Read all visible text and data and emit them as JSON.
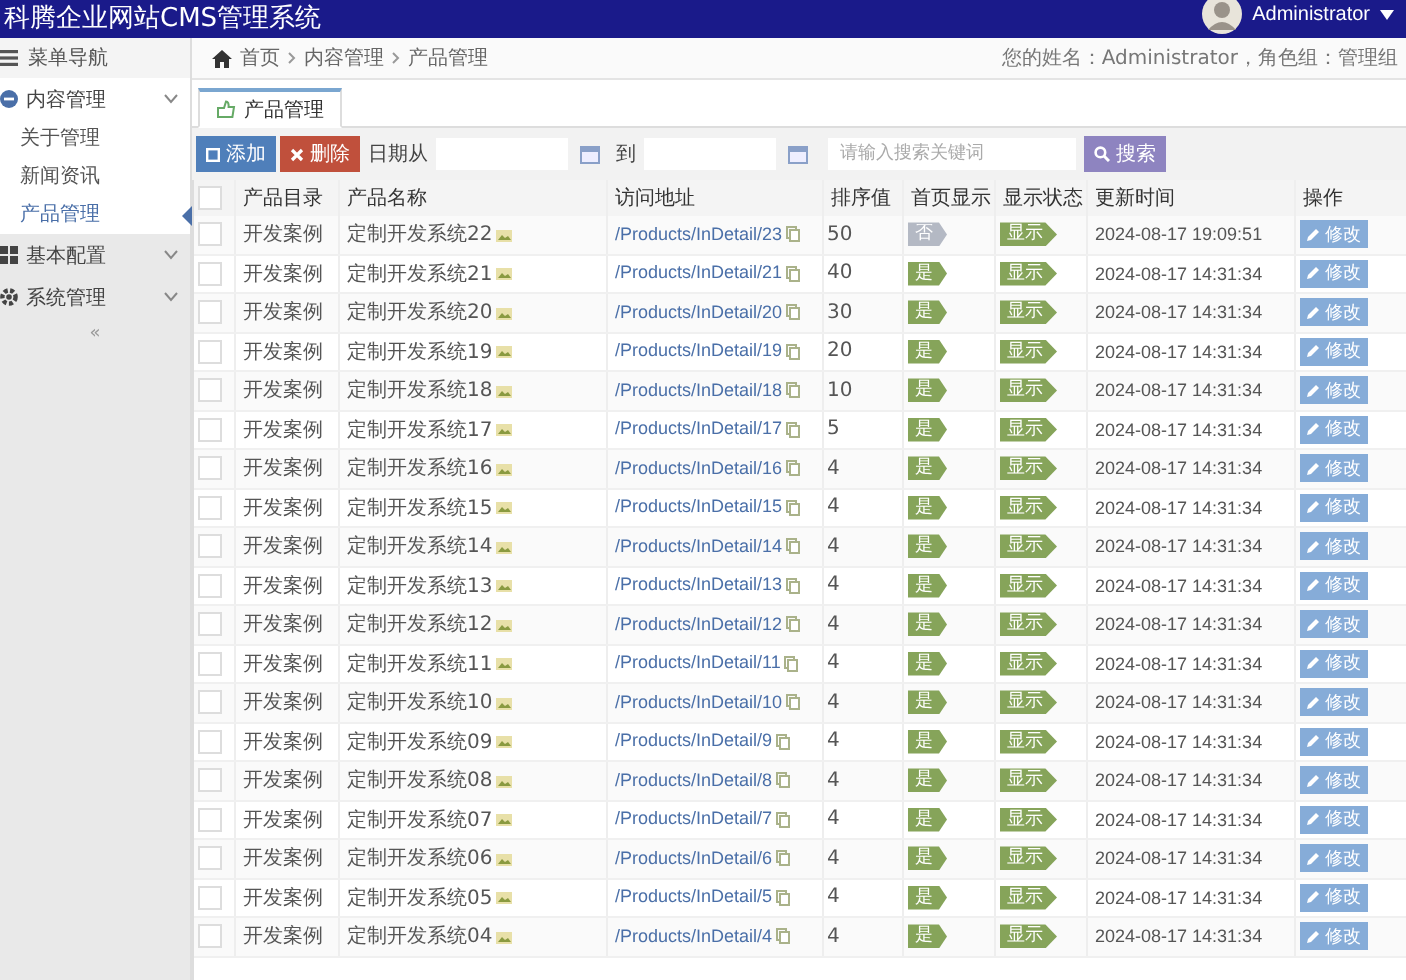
{
  "header": {
    "title": "科腾企业网站CMS管理系统",
    "user": "Administrator"
  },
  "sidebar": {
    "title": "菜单导航",
    "collapse": "«",
    "items": [
      {
        "label": "内容管理",
        "expanded": true,
        "children": [
          {
            "label": "关于管理",
            "selected": false
          },
          {
            "label": "新闻资讯",
            "selected": false
          },
          {
            "label": "产品管理",
            "selected": true
          }
        ]
      },
      {
        "label": "基本配置",
        "expanded": false
      },
      {
        "label": "系统管理",
        "expanded": false
      }
    ]
  },
  "breadcrumb": {
    "items": [
      "首页",
      "内容管理",
      "产品管理"
    ],
    "user_info": "您的姓名：Administrator，角色组：管理组"
  },
  "tabs": [
    {
      "label": "产品管理",
      "selected": true
    }
  ],
  "toolbar": {
    "add": "添加",
    "delete": "删除",
    "date_from": "日期从",
    "date_to": "到",
    "search_placeholder": "请输入搜索关键词",
    "search": "搜索"
  },
  "table": {
    "select_all_checked": false,
    "columns": [
      "产品目录",
      "产品名称",
      "访问地址",
      "排序值",
      "首页显示",
      "显示状态",
      "更新时间",
      "操作"
    ],
    "rows": [
      {
        "checked": false,
        "category": "开发案例",
        "name": "定制开发系统22",
        "url": "/Products/InDetail/23",
        "sort": "50",
        "home": {
          "text": "否",
          "on": false
        },
        "status": {
          "text": "显示",
          "on": true
        },
        "time": "2024-08-17 19:09:51",
        "action": "修改"
      },
      {
        "checked": false,
        "category": "开发案例",
        "name": "定制开发系统21",
        "url": "/Products/InDetail/21",
        "sort": "40",
        "home": {
          "text": "是",
          "on": true
        },
        "status": {
          "text": "显示",
          "on": true
        },
        "time": "2024-08-17 14:31:34",
        "action": "修改"
      },
      {
        "checked": false,
        "category": "开发案例",
        "name": "定制开发系统20",
        "url": "/Products/InDetail/20",
        "sort": "30",
        "home": {
          "text": "是",
          "on": true
        },
        "status": {
          "text": "显示",
          "on": true
        },
        "time": "2024-08-17 14:31:34",
        "action": "修改"
      },
      {
        "checked": false,
        "category": "开发案例",
        "name": "定制开发系统19",
        "url": "/Products/InDetail/19",
        "sort": "20",
        "home": {
          "text": "是",
          "on": true
        },
        "status": {
          "text": "显示",
          "on": true
        },
        "time": "2024-08-17 14:31:34",
        "action": "修改"
      },
      {
        "checked": false,
        "category": "开发案例",
        "name": "定制开发系统18",
        "url": "/Products/InDetail/18",
        "sort": "10",
        "home": {
          "text": "是",
          "on": true
        },
        "status": {
          "text": "显示",
          "on": true
        },
        "time": "2024-08-17 14:31:34",
        "action": "修改"
      },
      {
        "checked": false,
        "category": "开发案例",
        "name": "定制开发系统17",
        "url": "/Products/InDetail/17",
        "sort": "5",
        "home": {
          "text": "是",
          "on": true
        },
        "status": {
          "text": "显示",
          "on": true
        },
        "time": "2024-08-17 14:31:34",
        "action": "修改"
      },
      {
        "checked": false,
        "category": "开发案例",
        "name": "定制开发系统16",
        "url": "/Products/InDetail/16",
        "sort": "4",
        "home": {
          "text": "是",
          "on": true
        },
        "status": {
          "text": "显示",
          "on": true
        },
        "time": "2024-08-17 14:31:34",
        "action": "修改"
      },
      {
        "checked": false,
        "category": "开发案例",
        "name": "定制开发系统15",
        "url": "/Products/InDetail/15",
        "sort": "4",
        "home": {
          "text": "是",
          "on": true
        },
        "status": {
          "text": "显示",
          "on": true
        },
        "time": "2024-08-17 14:31:34",
        "action": "修改"
      },
      {
        "checked": false,
        "category": "开发案例",
        "name": "定制开发系统14",
        "url": "/Products/InDetail/14",
        "sort": "4",
        "home": {
          "text": "是",
          "on": true
        },
        "status": {
          "text": "显示",
          "on": true
        },
        "time": "2024-08-17 14:31:34",
        "action": "修改"
      },
      {
        "checked": false,
        "category": "开发案例",
        "name": "定制开发系统13",
        "url": "/Products/InDetail/13",
        "sort": "4",
        "home": {
          "text": "是",
          "on": true
        },
        "status": {
          "text": "显示",
          "on": true
        },
        "time": "2024-08-17 14:31:34",
        "action": "修改"
      },
      {
        "checked": false,
        "category": "开发案例",
        "name": "定制开发系统12",
        "url": "/Products/InDetail/12",
        "sort": "4",
        "home": {
          "text": "是",
          "on": true
        },
        "status": {
          "text": "显示",
          "on": true
        },
        "time": "2024-08-17 14:31:34",
        "action": "修改"
      },
      {
        "checked": false,
        "category": "开发案例",
        "name": "定制开发系统11",
        "url": "/Products/InDetail/11",
        "sort": "4",
        "home": {
          "text": "是",
          "on": true
        },
        "status": {
          "text": "显示",
          "on": true
        },
        "time": "2024-08-17 14:31:34",
        "action": "修改"
      },
      {
        "checked": false,
        "category": "开发案例",
        "name": "定制开发系统10",
        "url": "/Products/InDetail/10",
        "sort": "4",
        "home": {
          "text": "是",
          "on": true
        },
        "status": {
          "text": "显示",
          "on": true
        },
        "time": "2024-08-17 14:31:34",
        "action": "修改"
      },
      {
        "checked": false,
        "category": "开发案例",
        "name": "定制开发系统09",
        "url": "/Products/InDetail/9",
        "sort": "4",
        "home": {
          "text": "是",
          "on": true
        },
        "status": {
          "text": "显示",
          "on": true
        },
        "time": "2024-08-17 14:31:34",
        "action": "修改"
      },
      {
        "checked": false,
        "category": "开发案例",
        "name": "定制开发系统08",
        "url": "/Products/InDetail/8",
        "sort": "4",
        "home": {
          "text": "是",
          "on": true
        },
        "status": {
          "text": "显示",
          "on": true
        },
        "time": "2024-08-17 14:31:34",
        "action": "修改"
      },
      {
        "checked": false,
        "category": "开发案例",
        "name": "定制开发系统07",
        "url": "/Products/InDetail/7",
        "sort": "4",
        "home": {
          "text": "是",
          "on": true
        },
        "status": {
          "text": "显示",
          "on": true
        },
        "time": "2024-08-17 14:31:34",
        "action": "修改"
      },
      {
        "checked": false,
        "category": "开发案例",
        "name": "定制开发系统06",
        "url": "/Products/InDetail/6",
        "sort": "4",
        "home": {
          "text": "是",
          "on": true
        },
        "status": {
          "text": "显示",
          "on": true
        },
        "time": "2024-08-17 14:31:34",
        "action": "修改"
      },
      {
        "checked": false,
        "category": "开发案例",
        "name": "定制开发系统05",
        "url": "/Products/InDetail/5",
        "sort": "4",
        "home": {
          "text": "是",
          "on": true
        },
        "status": {
          "text": "显示",
          "on": true
        },
        "time": "2024-08-17 14:31:34",
        "action": "修改"
      },
      {
        "checked": false,
        "category": "开发案例",
        "name": "定制开发系统04",
        "url": "/Products/InDetail/4",
        "sort": "4",
        "home": {
          "text": "是",
          "on": true
        },
        "status": {
          "text": "显示",
          "on": true
        },
        "time": "2024-08-17 14:31:34",
        "action": "修改"
      }
    ]
  }
}
